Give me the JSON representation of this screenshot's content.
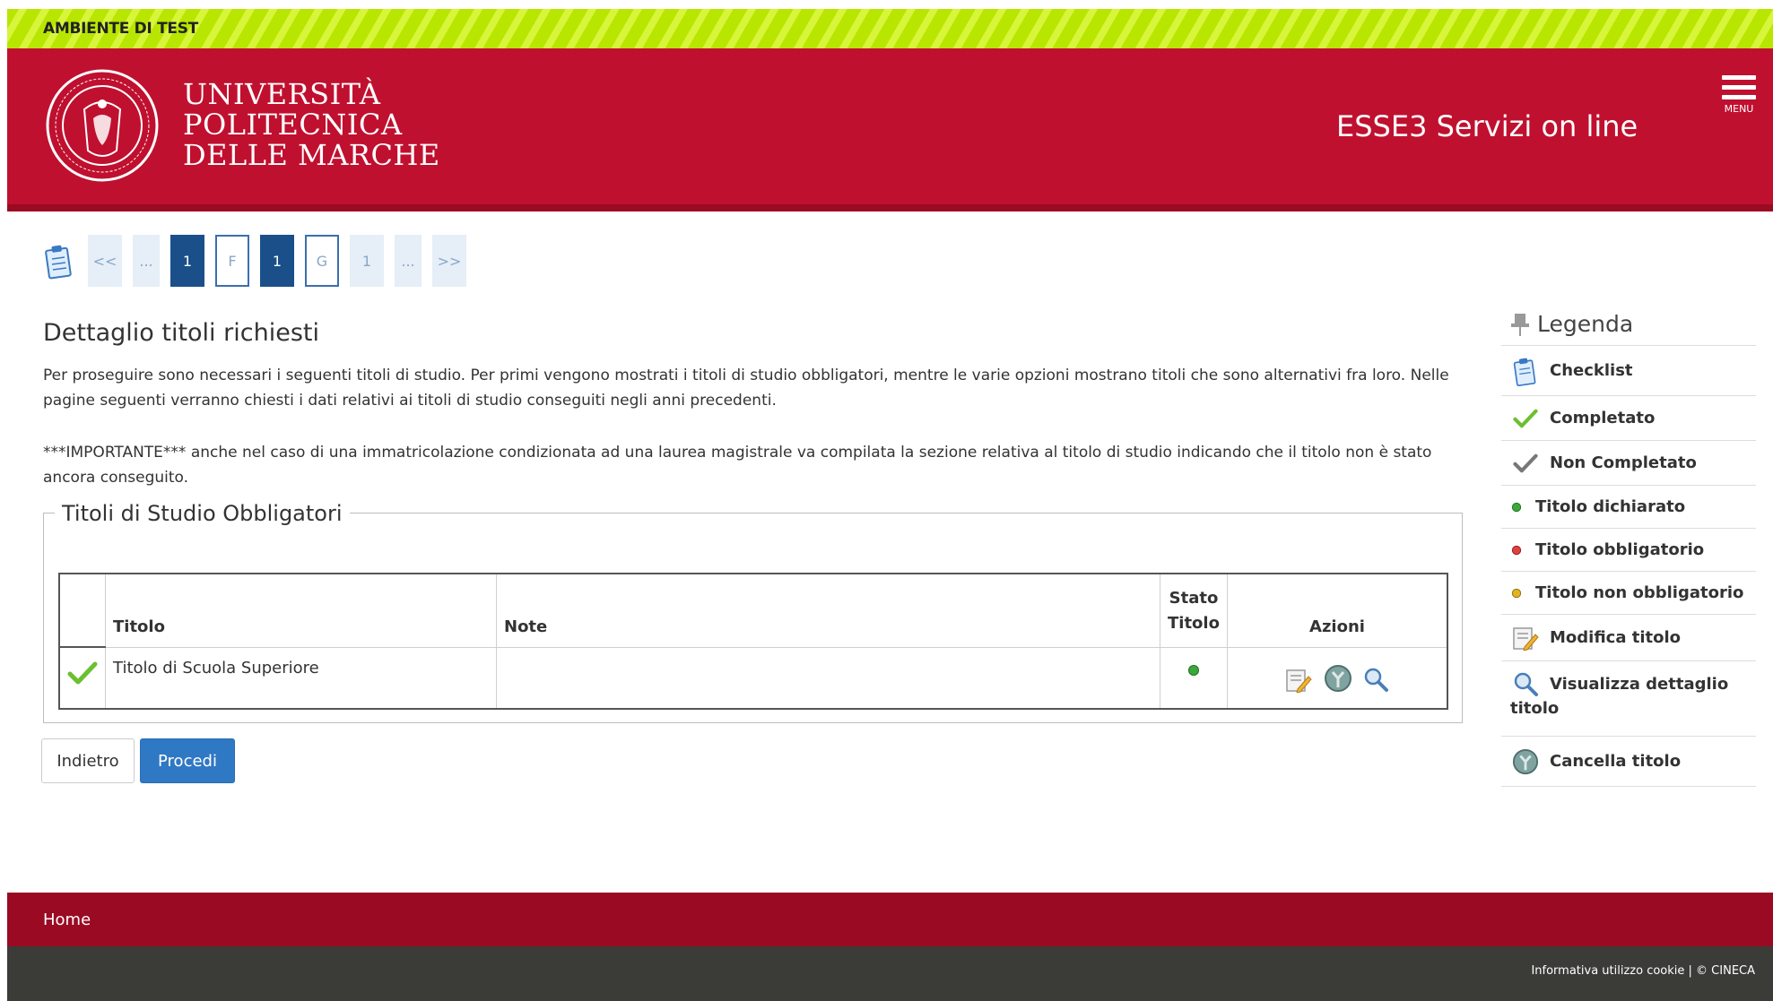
{
  "banner": {
    "label": "AMBIENTE DI TEST"
  },
  "header": {
    "university": [
      "UNIVERSITÀ",
      "POLITECNICA",
      "DELLE MARCHE"
    ],
    "app_title": "ESSE3 Servizi on line",
    "menu_label": "MENU"
  },
  "steps": [
    "<<",
    "...",
    "1",
    "F",
    "1",
    "G",
    "1",
    "...",
    ">>"
  ],
  "main": {
    "title": "Dettaglio titoli richiesti",
    "intro": "Per proseguire sono necessari i seguenti titoli di studio. Per primi vengono mostrati i titoli di studio obbligatori, mentre le varie opzioni mostrano titoli che sono alternativi fra loro. Nelle pagine seguenti verranno chiesti i dati relativi ai titoli di studio conseguiti negli anni precedenti.",
    "important": "***IMPORTANTE*** anche nel caso di una immatricolazione condizionata ad una laurea magistrale va compilata la sezione relativa al titolo di studio indicando che il titolo non è stato ancora conseguito."
  },
  "section": {
    "legend": "Titoli di Studio Obbligatori",
    "columns": {
      "titolo": "Titolo",
      "note": "Note",
      "stato_1": "Stato",
      "stato_2": "Titolo",
      "azioni": "Azioni"
    },
    "rows": [
      {
        "titolo": "Titolo di Scuola Superiore",
        "note": ""
      }
    ]
  },
  "buttons": {
    "back": "Indietro",
    "next": "Procedi"
  },
  "legend": {
    "title": "Legenda",
    "items": [
      "Checklist",
      "Completato",
      "Non Completato",
      "Titolo dichiarato",
      "Titolo obbligatorio",
      "Titolo non obbligatorio",
      "Modifica titolo",
      "Visualizza dettaglio",
      "titolo",
      "Cancella titolo"
    ]
  },
  "footer": {
    "home": "Home",
    "info": "Informativa utilizzo cookie | © CINECA"
  },
  "colors": {
    "brand": "#c0102f",
    "brand_dark": "#9a0a22",
    "accent": "#2f78c4",
    "test_banner": "#b8e600"
  }
}
